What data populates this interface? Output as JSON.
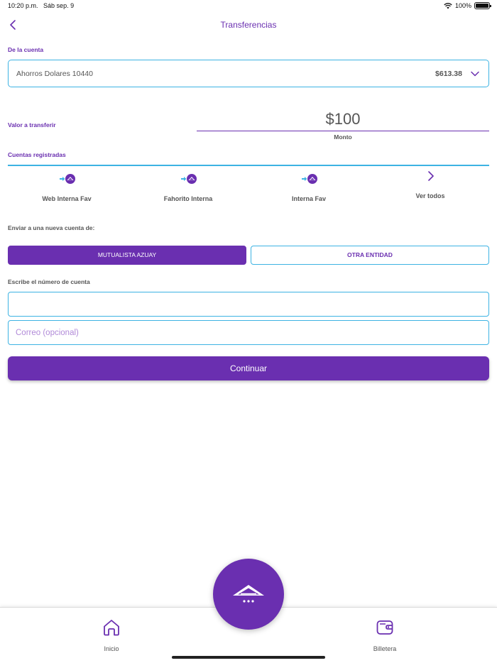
{
  "status_bar": {
    "time": "10:20 p.m.",
    "date": "Sáb sep. 9",
    "battery": "100%"
  },
  "header": {
    "title": "Transferencias"
  },
  "from_account": {
    "label": "De la cuenta",
    "name": "Ahorros Dolares  10440",
    "balance": "$613.38"
  },
  "amount": {
    "label": "Valor a transferir",
    "value": "$100",
    "caption": "Monto"
  },
  "registered": {
    "label": "Cuentas registradas",
    "items": [
      {
        "label": "Web Interna Fav",
        "icon": "favorite-account-icon"
      },
      {
        "label": "Fahorito Interna",
        "icon": "favorite-account-icon"
      },
      {
        "label": "Interna Fav",
        "icon": "favorite-account-icon"
      }
    ],
    "see_all": "Ver todos"
  },
  "new_account": {
    "label": "Enviar a una nueva cuenta de:",
    "options": [
      "MUTUALISTA AZUAY",
      "OTRA ENTIDAD"
    ],
    "selected": "MUTUALISTA AZUAY",
    "account_number_label": "Escribe el número de cuenta",
    "account_number_value": "",
    "email_placeholder": "Correo (opcional)"
  },
  "actions": {
    "continue": "Continuar"
  },
  "tab_bar": {
    "home": "Inicio",
    "wallet": "Billetera"
  },
  "colors": {
    "accent": "#6a2fb0",
    "border": "#3db3e3"
  }
}
